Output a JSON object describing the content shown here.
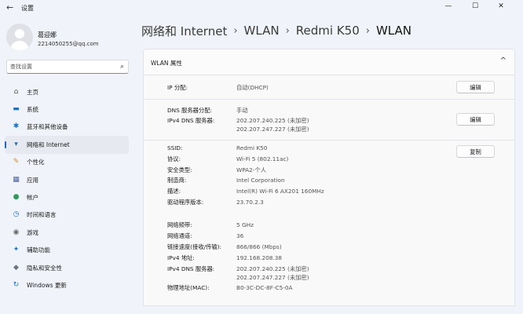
{
  "window": {
    "title": "设置",
    "back_icon": "←",
    "minimize": "—",
    "maximize": "☐",
    "close": "✕"
  },
  "user": {
    "name": "葛迎娜",
    "email": "2214050255@qq.com"
  },
  "search": {
    "placeholder": "查找设置",
    "icon": "⌕"
  },
  "sidebar": {
    "items": [
      {
        "label": "主页",
        "icon": "⌂",
        "color": "#555555"
      },
      {
        "label": "系统",
        "icon": "▬",
        "color": "#1a73c8"
      },
      {
        "label": "蓝牙和其他设备",
        "icon": "✱",
        "color": "#1a73c8"
      },
      {
        "label": "网络和 Internet",
        "icon": "▾",
        "color": "#1e6fb8",
        "active": true
      },
      {
        "label": "个性化",
        "icon": "✎",
        "color": "#d98a28"
      },
      {
        "label": "应用",
        "icon": "▦",
        "color": "#4a5ea8"
      },
      {
        "label": "帐户",
        "icon": "●",
        "color": "#2e9a5a"
      },
      {
        "label": "时间和语言",
        "icon": "◷",
        "color": "#1a73c8"
      },
      {
        "label": "游戏",
        "icon": "◉",
        "color": "#666666"
      },
      {
        "label": "辅助功能",
        "icon": "✦",
        "color": "#1a73c8"
      },
      {
        "label": "隐私和安全性",
        "icon": "◆",
        "color": "#6b7280"
      },
      {
        "label": "Windows 更新",
        "icon": "↻",
        "color": "#1a73c8"
      }
    ]
  },
  "breadcrumb": {
    "items": [
      "网络和 Internet",
      "WLAN",
      "Redmi K50",
      "WLAN"
    ],
    "separator": "›"
  },
  "card": {
    "title": "WLAN 属性",
    "chevron": "^"
  },
  "sections": {
    "ip": {
      "label": "IP 分配:",
      "value": "自动(DHCP)",
      "button": "编辑"
    },
    "dns": {
      "rows": [
        {
          "label": "DNS 服务器分配:",
          "value": "手动"
        },
        {
          "label": "IPv4 DNS 服务器:",
          "value": "202.207.240.225 (未加密)"
        },
        {
          "label": "",
          "value": "202.207.247.227 (未加密)"
        }
      ],
      "button": "编辑"
    },
    "props": {
      "rows": [
        {
          "label": "SSID:",
          "value": "Redmi K50"
        },
        {
          "label": "协议:",
          "value": "Wi-Fi 5 (802.11ac)"
        },
        {
          "label": "安全类型:",
          "value": "WPA2-个人"
        },
        {
          "label": "制造商:",
          "value": "Intel Corporation"
        },
        {
          "label": "描述:",
          "value": "Intel(R) Wi-Fi 6 AX201 160MHz"
        },
        {
          "label": "驱动程序版本:",
          "value": "23.70.2.3"
        },
        {
          "label": "网络频带:",
          "value": "5 GHz"
        },
        {
          "label": "网络通道:",
          "value": "36"
        },
        {
          "label": "链接速度(接收/传输):",
          "value": "866/866 (Mbps)"
        },
        {
          "label": "IPv4 地址:",
          "value": "192.168.208.38"
        },
        {
          "label": "IPv4 DNS 服务器:",
          "value": "202.207.240.225 (未加密)"
        },
        {
          "label": "",
          "value": "202.207.247.227 (未加密)"
        },
        {
          "label": "物理地址(MAC):",
          "value": "B0-3C-DC-8F-C5-0A"
        }
      ],
      "button": "复制"
    }
  }
}
